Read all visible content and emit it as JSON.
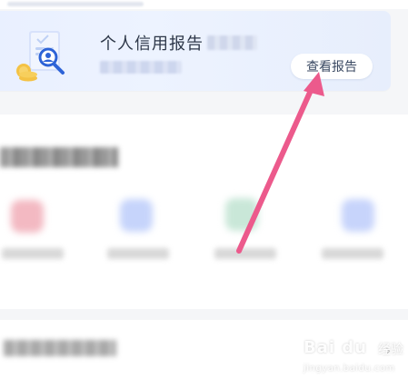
{
  "credit_card": {
    "title": "个人信用报告",
    "view_button": "查看报告",
    "icon": "credit-report-icon"
  },
  "section": {
    "service_icon_colors": [
      "#f3b9c2",
      "#c6d4fb",
      "#c9e7d8",
      "#c7d4fb"
    ]
  },
  "annotation": {
    "arrow_color": "#ec5a8c"
  },
  "watermark": {
    "logo": "Bai du",
    "suffix": "经验",
    "url": "jingyan.baidu.com"
  }
}
